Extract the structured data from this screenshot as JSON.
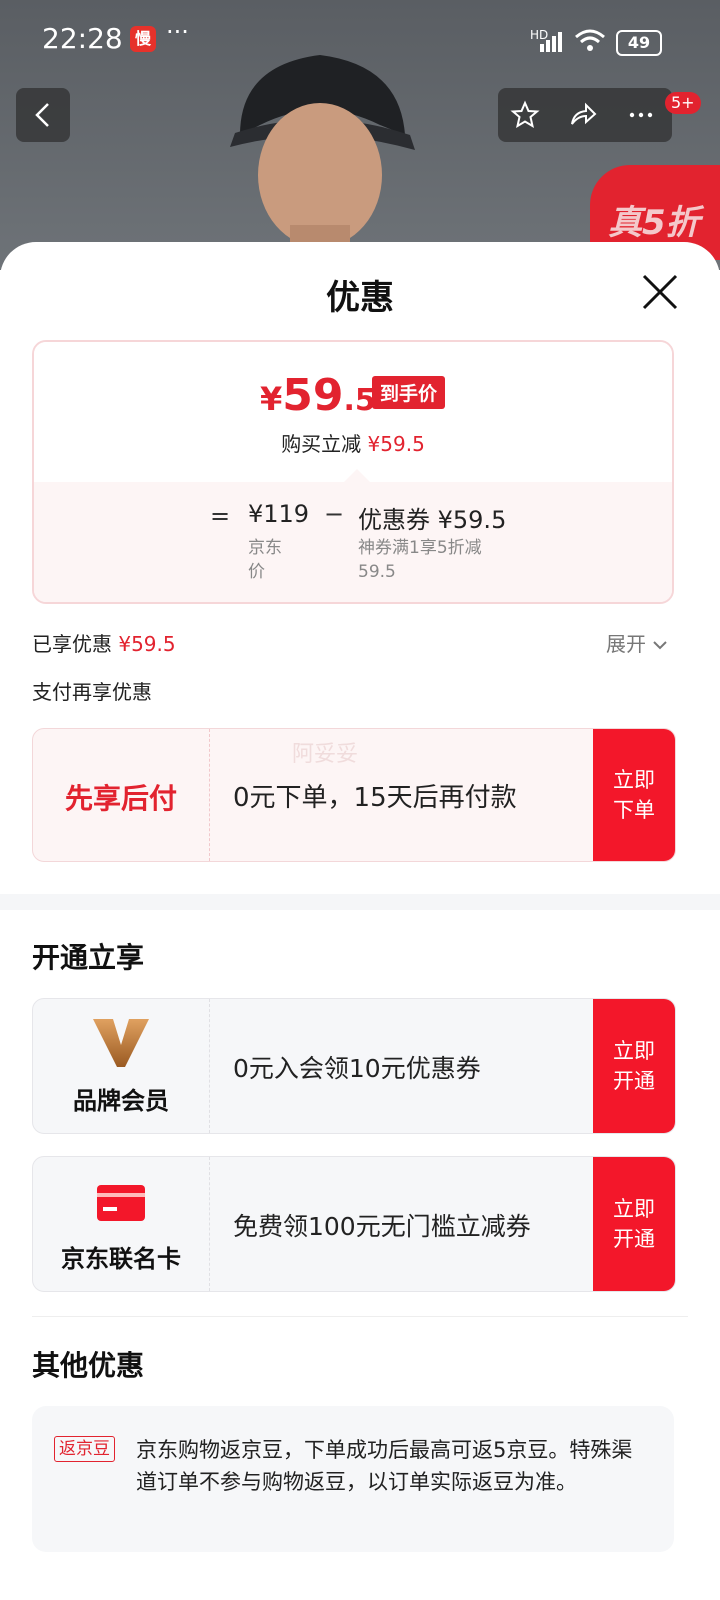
{
  "status_bar": {
    "time": "22:28",
    "app_badge": "慢",
    "more": "···",
    "network": "HD",
    "battery": "49"
  },
  "nav": {
    "badge": "5+",
    "ribbon_text": "真5折"
  },
  "sheet": {
    "title": "优惠",
    "price": {
      "yen": "¥",
      "int": "59",
      "dec": ".5",
      "tag": "到手价",
      "reduce_label": "购买立减",
      "reduce_value": "¥59.5"
    },
    "breakdown": {
      "eq": "=",
      "jd_price": "¥119",
      "jd_price_label": "京东价",
      "minus": "−",
      "coupon": "优惠券 ¥59.5",
      "coupon_desc": "神券满1享5折减59.5"
    },
    "enjoyed_label": "已享优惠",
    "enjoyed_value": "¥59.5",
    "expand": "展开",
    "pay_more": "支付再享优惠",
    "pay_card": {
      "left": "先享后付",
      "mid": "0元下单，15天后再付款",
      "btn": "立即下单",
      "watermark": "阿妥妥"
    },
    "open_title": "开通立享",
    "member_card": {
      "left": "品牌会员",
      "mid": "0元入会领10元优惠券",
      "btn": "立即开通"
    },
    "credit_card": {
      "left": "京东联名卡",
      "mid": "免费领100元无门槛立减券",
      "btn": "立即开通"
    },
    "other_title": "其他优惠",
    "other": {
      "tag": "返京豆",
      "text": "京东购物返京豆，下单成功后最高可返5京豆。特殊渠道订单不参与购物返豆，以订单实际返豆为准。"
    }
  }
}
